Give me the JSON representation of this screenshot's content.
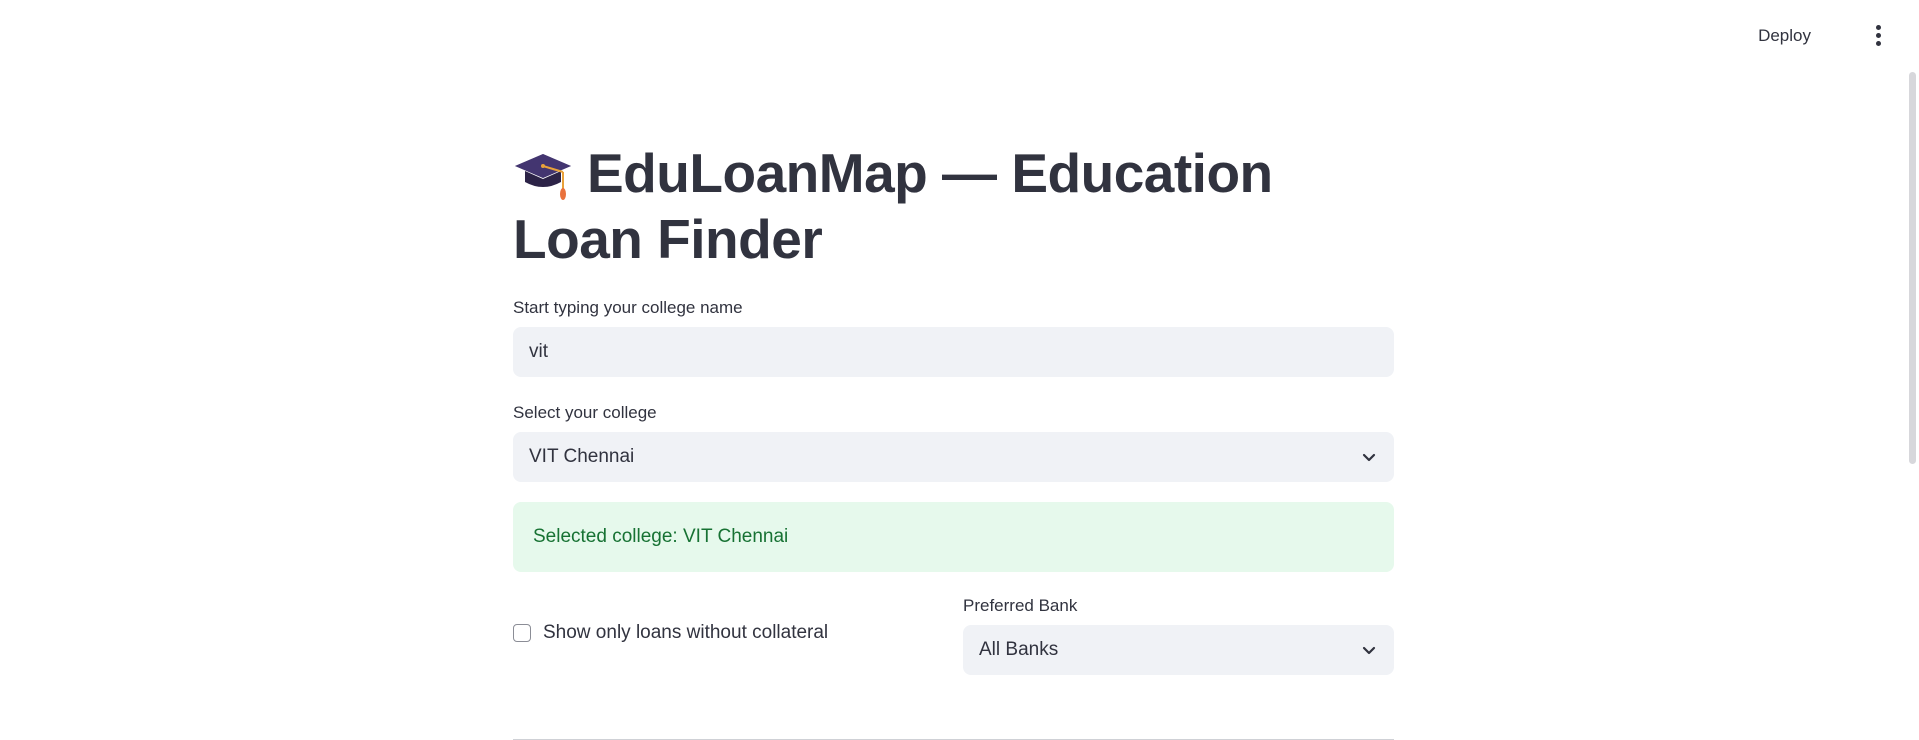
{
  "header": {
    "deploy_label": "Deploy",
    "menu_icon": "more-vertical-icon"
  },
  "page": {
    "title_icon": "graduation-cap-icon",
    "title": "EduLoanMap — Education Loan Finder"
  },
  "search": {
    "label": "Start typing your college name",
    "value": "vit"
  },
  "college_select": {
    "label": "Select your college",
    "selected": "VIT Chennai"
  },
  "success_message": {
    "text": "Selected college: VIT Chennai"
  },
  "filters": {
    "collateral_checkbox_label": "Show only loans without collateral",
    "collateral_checked": false,
    "bank_label": "Preferred Bank",
    "bank_selected": "All Banks"
  },
  "colors": {
    "text": "#31333f",
    "input_bg": "#f0f2f6",
    "success_bg": "#e6f9ec",
    "success_text": "#177233"
  }
}
